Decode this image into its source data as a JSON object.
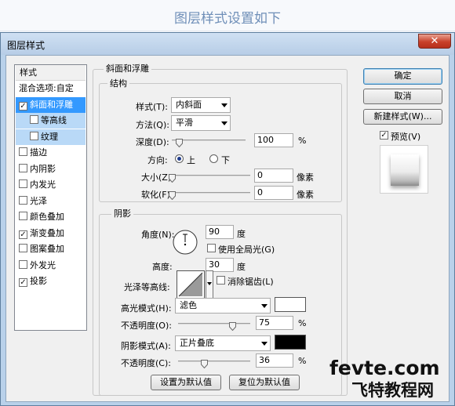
{
  "banner": {
    "text": "图层样式设置如下"
  },
  "window": {
    "title": "图层样式",
    "close_glyph": "✕"
  },
  "styles_list": {
    "header": "样式",
    "items": [
      {
        "label": "混合选项:自定",
        "checkbox": false,
        "checked": false,
        "state": "normal",
        "indent": false
      },
      {
        "label": "斜面和浮雕",
        "checkbox": true,
        "checked": true,
        "state": "selected",
        "indent": false
      },
      {
        "label": "等高线",
        "checkbox": true,
        "checked": false,
        "state": "highlight",
        "indent": true
      },
      {
        "label": "纹理",
        "checkbox": true,
        "checked": false,
        "state": "highlight",
        "indent": true
      },
      {
        "label": "描边",
        "checkbox": true,
        "checked": false,
        "state": "normal",
        "indent": false
      },
      {
        "label": "内阴影",
        "checkbox": true,
        "checked": false,
        "state": "normal",
        "indent": false
      },
      {
        "label": "内发光",
        "checkbox": true,
        "checked": false,
        "state": "normal",
        "indent": false
      },
      {
        "label": "光泽",
        "checkbox": true,
        "checked": false,
        "state": "normal",
        "indent": false
      },
      {
        "label": "颜色叠加",
        "checkbox": true,
        "checked": false,
        "state": "normal",
        "indent": false
      },
      {
        "label": "渐变叠加",
        "checkbox": true,
        "checked": true,
        "state": "normal",
        "indent": false
      },
      {
        "label": "图案叠加",
        "checkbox": true,
        "checked": false,
        "state": "normal",
        "indent": false
      },
      {
        "label": "外发光",
        "checkbox": true,
        "checked": false,
        "state": "normal",
        "indent": false
      },
      {
        "label": "投影",
        "checkbox": true,
        "checked": true,
        "state": "normal",
        "indent": false
      }
    ]
  },
  "bevel": {
    "group_title": "斜面和浮雕",
    "structure_title": "结构",
    "style": {
      "label": "样式(T):",
      "value": "内斜面"
    },
    "technique": {
      "label": "方法(Q):",
      "value": "平滑"
    },
    "depth": {
      "label": "深度(D):",
      "value": "100",
      "unit": "%",
      "slider_fraction": 0.1
    },
    "direction": {
      "label": "方向:",
      "up": "上",
      "down": "下",
      "selected": "up"
    },
    "size": {
      "label": "大小(Z):",
      "value": "0",
      "unit": "像素",
      "slider_fraction": 0
    },
    "soften": {
      "label": "软化(F):",
      "value": "0",
      "unit": "像素",
      "slider_fraction": 0
    }
  },
  "shading": {
    "title": "阴影",
    "angle": {
      "label": "角度(N):",
      "value": "90",
      "unit": "度"
    },
    "global_light": {
      "label": "使用全局光(G)",
      "checked": false
    },
    "altitude": {
      "label": "高度:",
      "value": "30",
      "unit": "度"
    },
    "gloss_contour": {
      "label": "光泽等高线:"
    },
    "anti_aliased": {
      "label": "消除锯齿(L)",
      "checked": false
    },
    "highlight_mode": {
      "label": "高光模式(H):",
      "value": "滤色",
      "color": "#ffffff"
    },
    "highlight_opacity": {
      "label": "不透明度(O):",
      "value": "75",
      "unit": "%",
      "slider_fraction": 0.75
    },
    "shadow_mode": {
      "label": "阴影模式(A):",
      "value": "正片叠底",
      "color": "#000000"
    },
    "shadow_opacity": {
      "label": "不透明度(C):",
      "value": "36",
      "unit": "%",
      "slider_fraction": 0.36
    }
  },
  "buttons": {
    "make_default": "设置为默认值",
    "reset_default": "复位为默认值",
    "ok": "确定",
    "cancel": "取消",
    "new_style": "新建样式(W)...",
    "preview": "预览(V)",
    "preview_checked": true
  },
  "watermark": {
    "line1": "fevte.com",
    "line2": "飞特教程网"
  }
}
